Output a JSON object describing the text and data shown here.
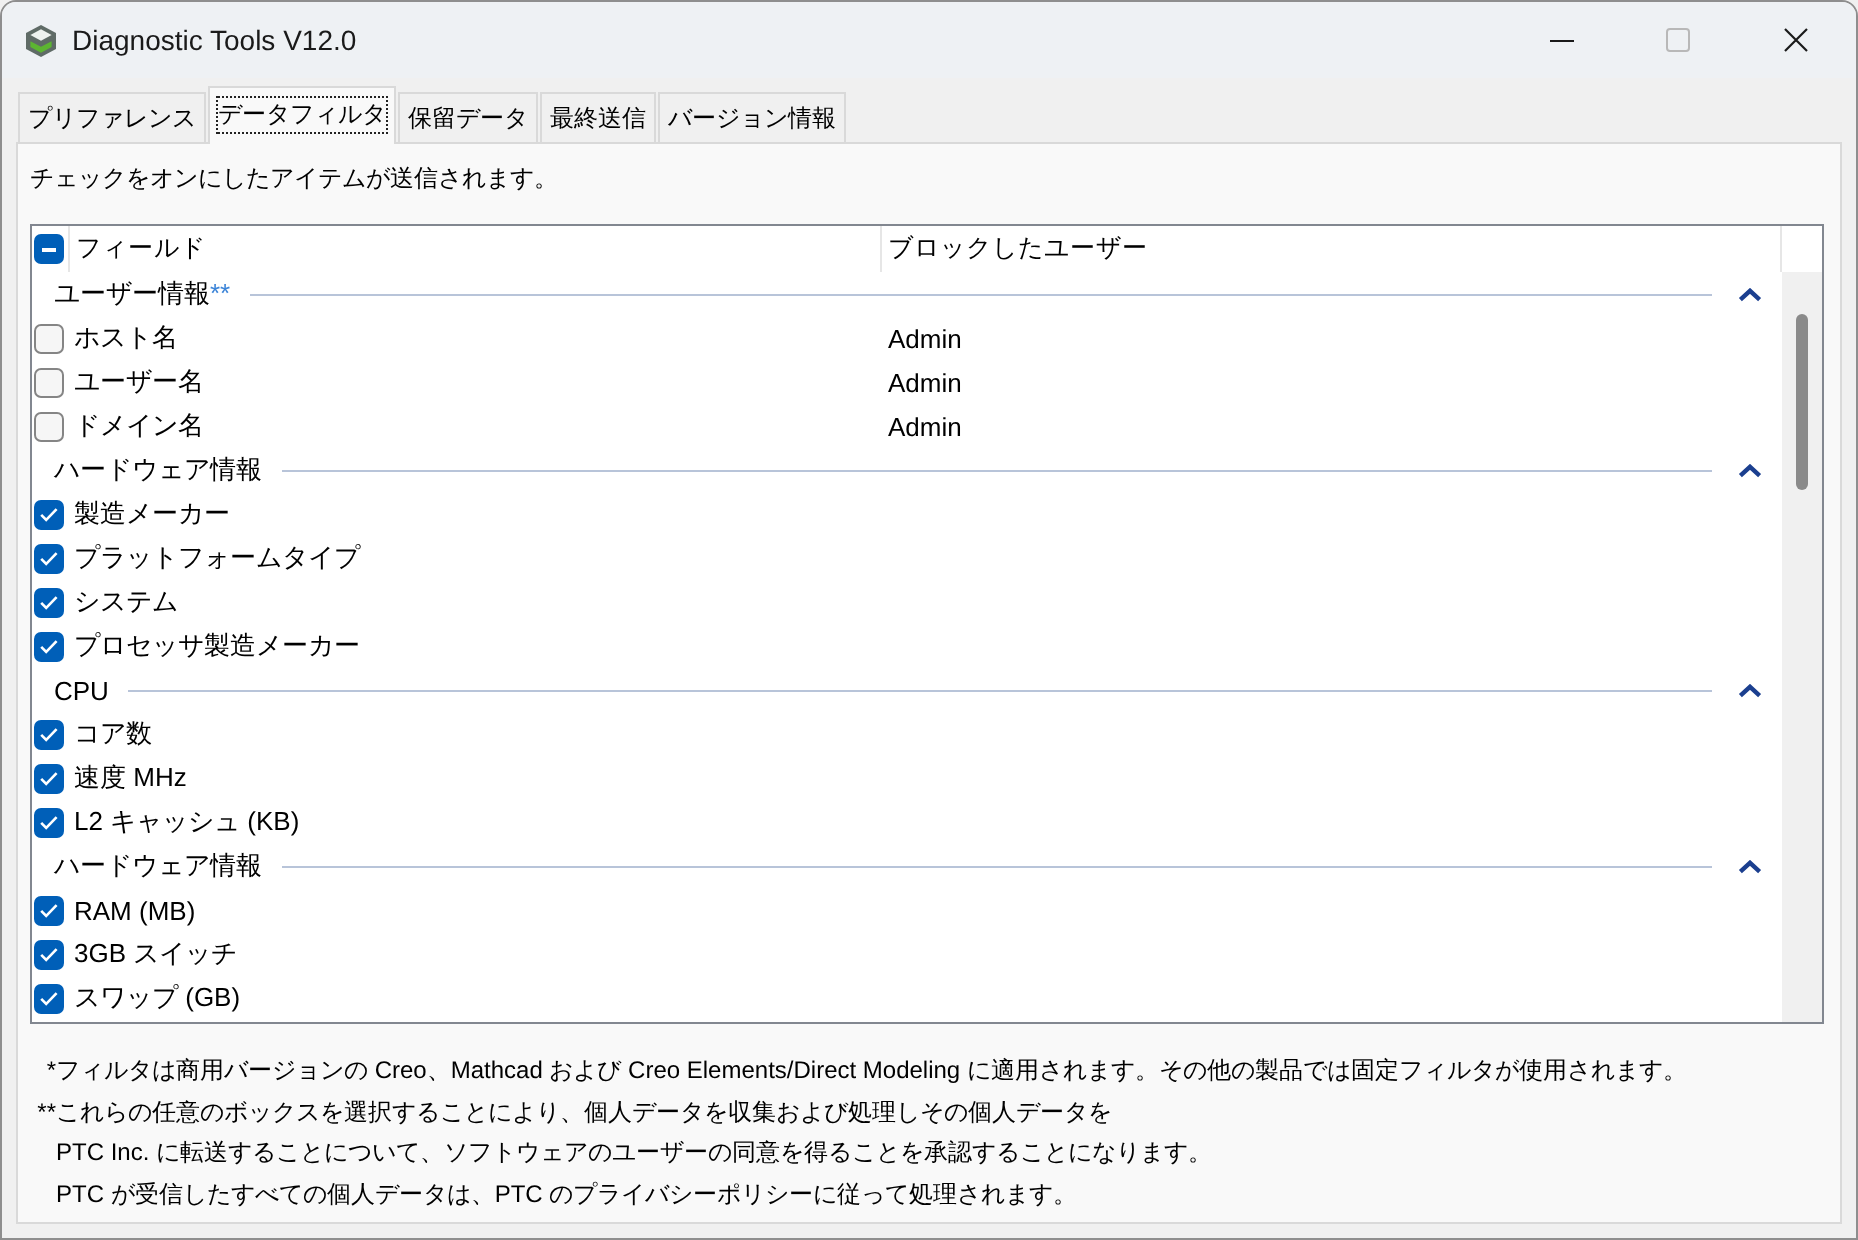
{
  "window": {
    "title": "Diagnostic Tools V12.0",
    "maximize_disabled": true
  },
  "tabs": [
    {
      "label": "プリファレンス",
      "selected": false
    },
    {
      "label": "データフィルタ",
      "selected": true
    },
    {
      "label": "保留データ",
      "selected": false
    },
    {
      "label": "最終送信",
      "selected": false
    },
    {
      "label": "バージョン情報",
      "selected": false
    }
  ],
  "description": "チェックをオンにしたアイテムが送信されます。",
  "field_list": {
    "select_all": {
      "indeterminate": true
    },
    "columns": [
      {
        "label": "フィールド"
      },
      {
        "label": "ブロックしたユーザー"
      }
    ],
    "groups": [
      {
        "title": "ユーザー情報",
        "note_mark": "**",
        "expanded": true,
        "rows": [
          {
            "label": "ホスト名",
            "checked": false,
            "blocked_user": "Admin"
          },
          {
            "label": "ユーザー名",
            "checked": false,
            "blocked_user": "Admin"
          },
          {
            "label": "ドメイン名",
            "checked": false,
            "blocked_user": "Admin"
          }
        ]
      },
      {
        "title": "ハードウェア情報",
        "expanded": true,
        "rows": [
          {
            "label": "製造メーカー",
            "checked": true
          },
          {
            "label": "プラットフォームタイプ",
            "checked": true
          },
          {
            "label": "システム",
            "checked": true
          },
          {
            "label": "プロセッサ製造メーカー",
            "checked": true
          }
        ]
      },
      {
        "title": "CPU",
        "expanded": true,
        "rows": [
          {
            "label": "コア数",
            "checked": true
          },
          {
            "label": "速度 MHz",
            "checked": true
          },
          {
            "label": "L2 キャッシュ (KB)",
            "checked": true
          }
        ]
      },
      {
        "title": "ハードウェア情報",
        "expanded": true,
        "rows": [
          {
            "label": "RAM (MB)",
            "checked": true
          },
          {
            "label": "3GB スイッチ",
            "checked": true
          },
          {
            "label": "スワップ (GB)",
            "checked": true
          }
        ]
      }
    ]
  },
  "footnotes": [
    {
      "mark": "*",
      "lines": [
        "フィルタは商用バージョンの Creo、Mathcad および Creo Elements/Direct Modeling に適用されます。その他の製品では固定フィルタが使用されます。"
      ]
    },
    {
      "mark": "**",
      "lines": [
        "これらの任意のボックスを選択することにより、個人データを収集および処理しその個人データを",
        "PTC Inc. に転送することについて、ソフトウェアのユーザーの同意を得ることを承認することになります。",
        "PTC が受信したすべての個人データは、PTC のプライバシーポリシーに従って処理されます。"
      ]
    }
  ]
}
